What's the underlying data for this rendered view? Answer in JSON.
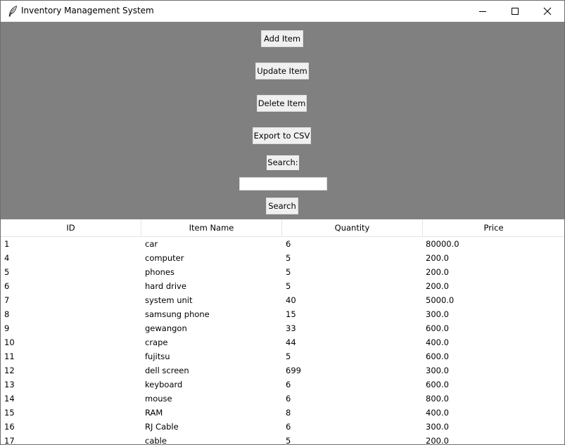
{
  "window": {
    "title": "Inventory Management System",
    "icon": "feather-icon"
  },
  "controls": {
    "add_label": "Add Item",
    "update_label": "Update Item",
    "delete_label": "Delete Item",
    "export_label": "Export to CSV",
    "search_label": "Search:",
    "search_value": "",
    "search_button_label": "Search"
  },
  "table": {
    "columns": [
      "ID",
      "Item Name",
      "Quantity",
      "Price"
    ],
    "rows": [
      [
        "1",
        "car",
        "6",
        "80000.0"
      ],
      [
        "4",
        "computer",
        "5",
        "200.0"
      ],
      [
        "5",
        "phones",
        "5",
        "200.0"
      ],
      [
        "6",
        "hard drive",
        "5",
        "200.0"
      ],
      [
        "7",
        "system unit",
        "40",
        "5000.0"
      ],
      [
        "8",
        "samsung phone",
        "15",
        "300.0"
      ],
      [
        "9",
        "gewangon",
        "33",
        "600.0"
      ],
      [
        "10",
        "crape",
        "44",
        "400.0"
      ],
      [
        "11",
        "fujitsu",
        "5",
        "600.0"
      ],
      [
        "12",
        "dell screen",
        "699",
        "300.0"
      ],
      [
        "13",
        "keyboard",
        "6",
        "600.0"
      ],
      [
        "14",
        "mouse",
        "6",
        "800.0"
      ],
      [
        "15",
        "RAM",
        "8",
        "400.0"
      ],
      [
        "16",
        "RJ Cable",
        "6",
        "300.0"
      ],
      [
        "17",
        "cable",
        "5",
        "200.0"
      ]
    ]
  },
  "colors": {
    "panel_background": "#808080",
    "button_background": "#f0f0f0"
  }
}
